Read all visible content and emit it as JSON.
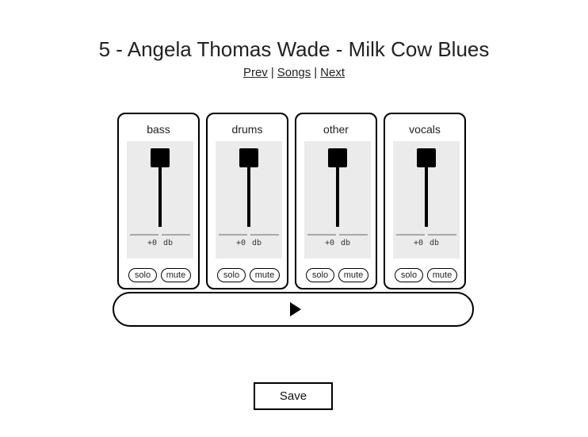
{
  "page": {
    "title": "5 - Angela Thomas Wade - Milk Cow Blues"
  },
  "nav": {
    "prev": "Prev",
    "separator1": "|",
    "songs": "Songs",
    "separator2": "|",
    "next": "Next"
  },
  "channels": [
    {
      "name": "bass",
      "gain": "+0",
      "unit": "db",
      "solo_label": "solo",
      "mute_label": "mute"
    },
    {
      "name": "drums",
      "gain": "+0",
      "unit": "db",
      "solo_label": "solo",
      "mute_label": "mute"
    },
    {
      "name": "other",
      "gain": "+0",
      "unit": "db",
      "solo_label": "solo",
      "mute_label": "mute"
    },
    {
      "name": "vocals",
      "gain": "+0",
      "unit": "db",
      "solo_label": "solo",
      "mute_label": "mute"
    }
  ],
  "transport": {
    "play_icon": "play-icon"
  },
  "actions": {
    "save_label": "Save"
  },
  "colors": {
    "fader_background": "#ebebeb",
    "border": "#000000",
    "text": "#222222"
  }
}
